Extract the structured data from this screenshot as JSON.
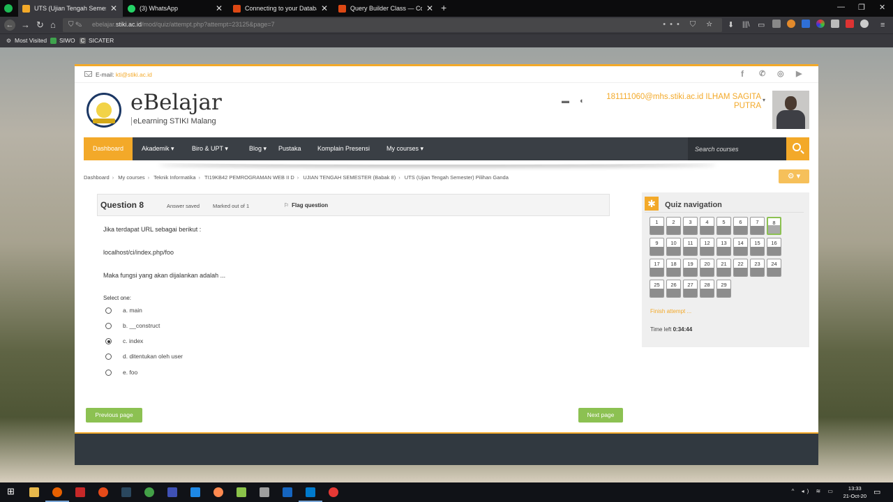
{
  "browser": {
    "tabs": [
      {
        "title": "UTS (Ujian Tengah Semester) Pi",
        "color": "#f3a929"
      },
      {
        "title": "(3) WhatsApp",
        "color": "#25d366"
      },
      {
        "title": "Connecting to your Database -",
        "color": "#dd4814"
      },
      {
        "title": "Query Builder Class — Codeig",
        "color": "#dd4814"
      }
    ],
    "url_prefix": "ebelajar.",
    "url_host": "stiki.ac.id",
    "url_path": "/mod/quiz/attempt.php?attempt=23125&page=7",
    "bookmarks": [
      "Most Visited",
      "SIWO",
      "SICATER"
    ]
  },
  "site": {
    "email_label": "E-mail:",
    "email": "kti@stiki.ac.id",
    "title": "eBelajar",
    "subtitle": "eLearning STIKI Malang",
    "user_name": "181111060@mhs.stiki.ac.id ILHAM SAGITA PUTRA",
    "menu": [
      "Dashboard",
      "Akademik ▾",
      "Biro & UPT ▾",
      "Blog ▾",
      "Pustaka",
      "Komplain Presensi",
      "My courses ▾"
    ],
    "search_placeholder": "Search courses"
  },
  "breadcrumb": [
    "Dashboard",
    "My courses",
    "Teknik Informatika",
    "TI19KB42 PEMROGRAMAN WEB II D",
    "UJIAN TENGAH SEMESTER (Babak 8)",
    "UTS (Ujian Tengah Semester) Pilihan Ganda"
  ],
  "question": {
    "number_label": "Question 8",
    "state": "Answer saved",
    "grade": "Marked out of 1",
    "flag_label": "Flag question",
    "text_1": "Jika terdapat URL sebagai berikut :",
    "text_2": "localhost/ci/index.php/foo",
    "text_3": "Maka fungsi yang akan dijalankan adalah ...",
    "prompt": "Select one:",
    "options": [
      {
        "label": "a. main",
        "selected": false
      },
      {
        "label": "b. __construct",
        "selected": false
      },
      {
        "label": "c. index",
        "selected": true
      },
      {
        "label": "d. ditentukan oleh user",
        "selected": false
      },
      {
        "label": "e. foo",
        "selected": false
      }
    ]
  },
  "buttons": {
    "previous": "Previous page",
    "next": "Next page"
  },
  "quiz_nav": {
    "title": "Quiz navigation",
    "questions": [
      "1",
      "2",
      "3",
      "4",
      "5",
      "6",
      "7",
      "8",
      "9",
      "10",
      "11",
      "12",
      "13",
      "14",
      "15",
      "16",
      "17",
      "18",
      "19",
      "20",
      "21",
      "22",
      "23",
      "24",
      "25",
      "26",
      "27",
      "28",
      "29"
    ],
    "current": "8",
    "finish_label": "Finish attempt ...",
    "time_label": "Time left",
    "time_value": "0:34:44"
  },
  "taskbar": {
    "time": "13:33",
    "date": "21-Oct-20"
  }
}
